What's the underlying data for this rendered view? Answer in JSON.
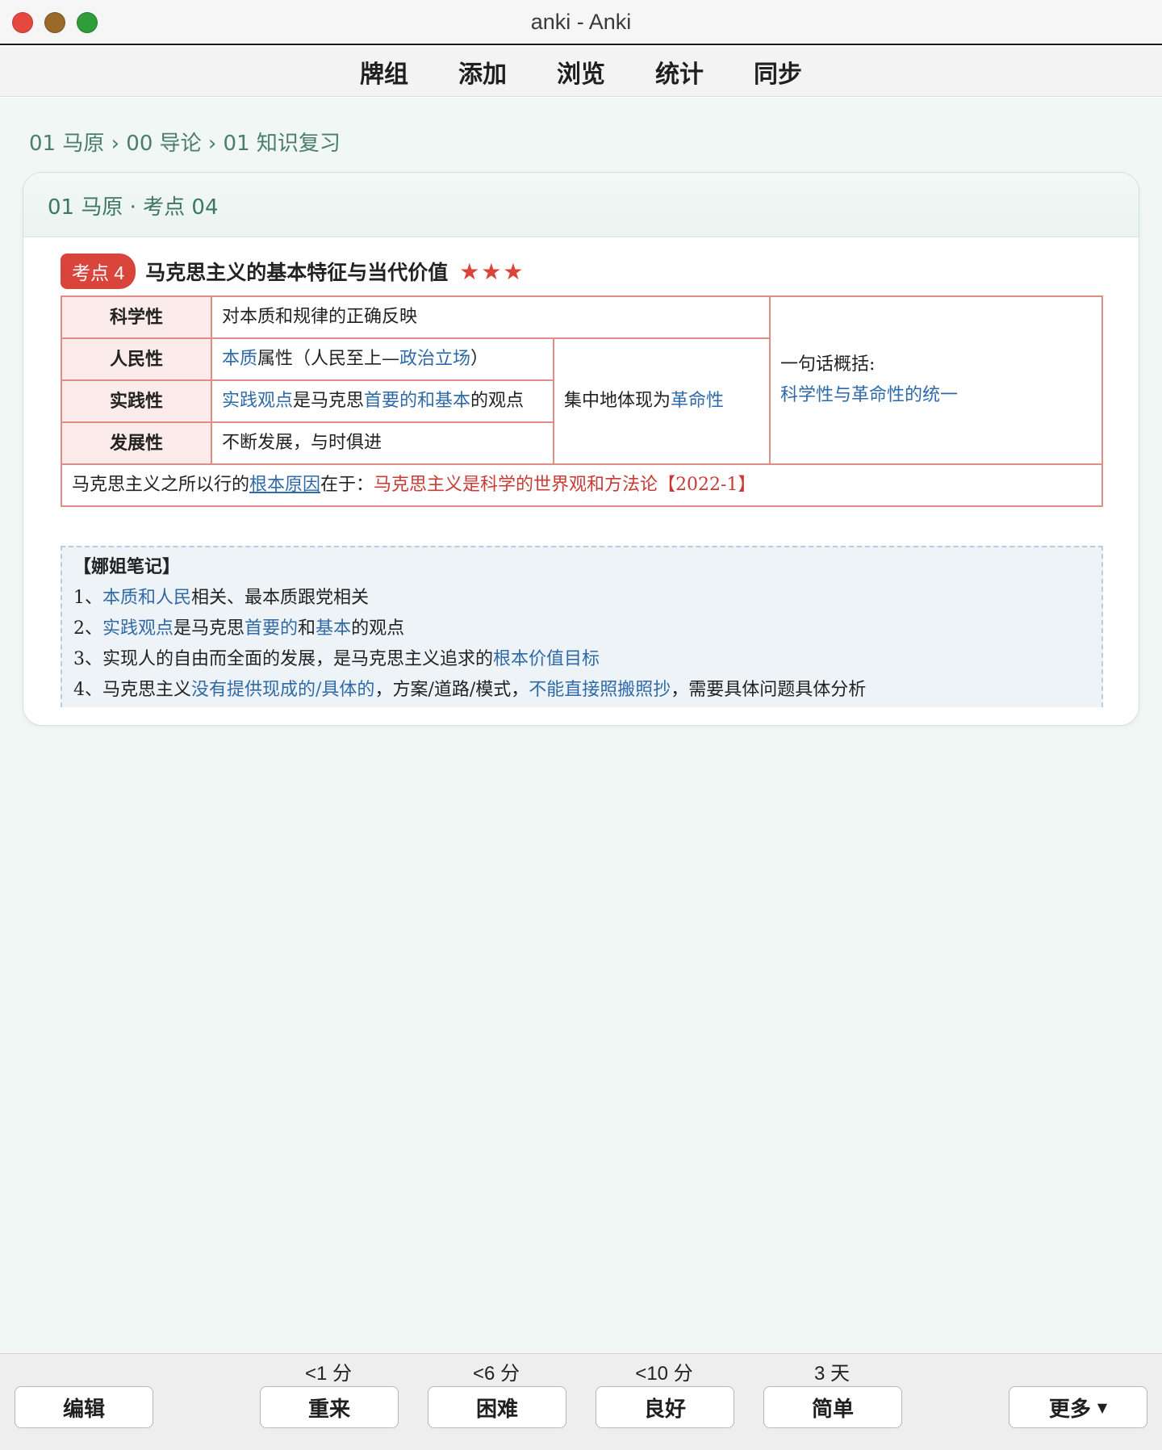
{
  "window": {
    "title": "anki - Anki"
  },
  "nav": {
    "items": [
      "牌组",
      "添加",
      "浏览",
      "统计",
      "同步"
    ]
  },
  "breadcrumb": "01 马原 › 00 导论 › 01 知识复习",
  "card": {
    "header": "01 马原 · 考点 04",
    "badge": "考点 4",
    "title": "马克思主义的基本特征与当代价值",
    "stars": "★★★",
    "rows": [
      {
        "label": "科学性",
        "desc": "对本质和规律的正确反映"
      },
      {
        "label": "人民性",
        "desc_blue1": "本质",
        "desc_mid": "属性（人民至上—",
        "desc_blue2": "政治立场",
        "desc_end": "）"
      },
      {
        "label": "实践性",
        "desc_blue1": "实践观点",
        "desc_mid": "是马克思",
        "desc_blue2": "首要的和基本",
        "desc_end": "的观点"
      },
      {
        "label": "发展性",
        "desc": "不断发展，与时俱进"
      }
    ],
    "middle": {
      "text": "集中地体现为",
      "highlight": "革命性"
    },
    "summary": {
      "label": "一句话概括:",
      "text": "科学性与革命性的统一"
    },
    "bottom": {
      "prefix": "马克思主义之所以行的",
      "link": "根本原因",
      "mid": "在于：",
      "red": "马克思主义是科学的世界观和方法论",
      "tag": "【2022-1】"
    },
    "notes": {
      "title": "【娜姐笔记】",
      "lines": [
        {
          "num": "1、",
          "blue": "本质和人民",
          "rest": "相关、最本质跟党相关"
        },
        {
          "num": "2、",
          "blue": "实践观点",
          "mid": "是马克思",
          "blue2": "首要的",
          "mid2": "和",
          "blue3": "基本",
          "rest": "的观点"
        },
        {
          "num": "3、",
          "text": "实现人的自由而全面的发展，是马克思主义追求的",
          "blue": "根本价值目标"
        },
        {
          "num": "4、",
          "text": "马克思主义",
          "blue": "没有提供现成的/具体的",
          "mid": "，方案/道路/模式，",
          "blue2": "不能直接照搬照抄",
          "rest": "，需要具体问题具体分析"
        }
      ]
    }
  },
  "answer_bar": {
    "edit": "编辑",
    "more": "更多",
    "buttons": [
      {
        "label": "重来",
        "interval": "<1 分"
      },
      {
        "label": "困难",
        "interval": "<6 分"
      },
      {
        "label": "良好",
        "interval": "<10 分"
      },
      {
        "label": "简单",
        "interval": "3 天"
      }
    ]
  },
  "colors": {
    "accent_red": "#d9443b",
    "accent_blue": "#2f6aa8",
    "header_green": "#3f7564",
    "background": "#f1f7f5"
  }
}
